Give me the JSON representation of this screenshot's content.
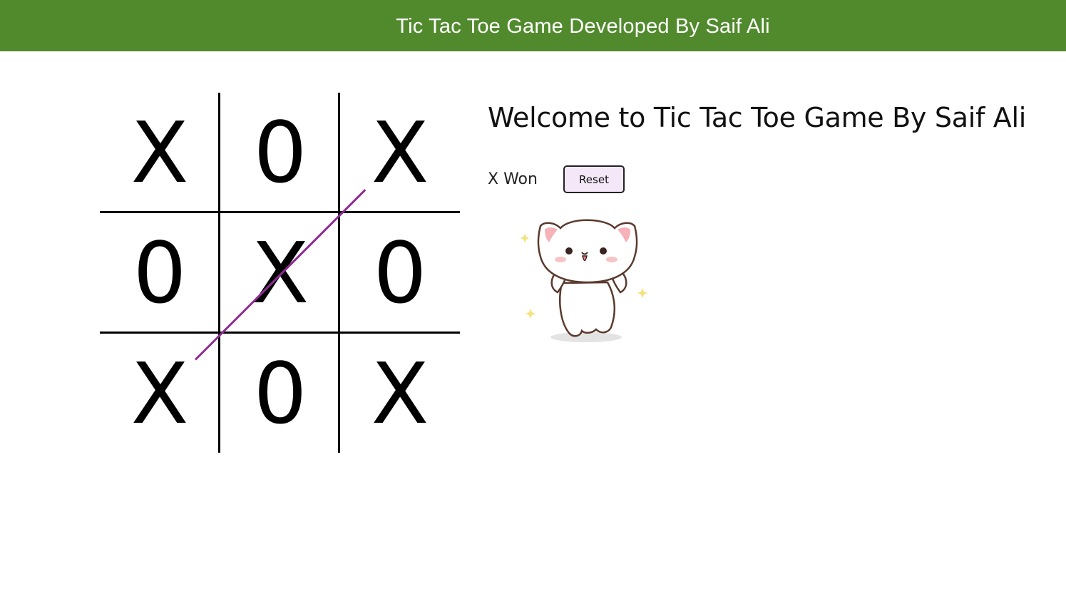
{
  "navbar": {
    "title": "Tic Tac Toe Game Developed By Saif Ali",
    "background_color": "#518a2d"
  },
  "board": {
    "cells": [
      "X",
      "0",
      "X",
      "0",
      "X",
      "0",
      "X",
      "0",
      "X"
    ],
    "win_line_color": "#8e2a93"
  },
  "info": {
    "heading": "Welcome to Tic Tac Toe Game By Saif Ali",
    "status": "X Won",
    "reset_label": "Reset",
    "reset_color": "#f3e7f8",
    "image": "dancing-cat-sticker"
  }
}
